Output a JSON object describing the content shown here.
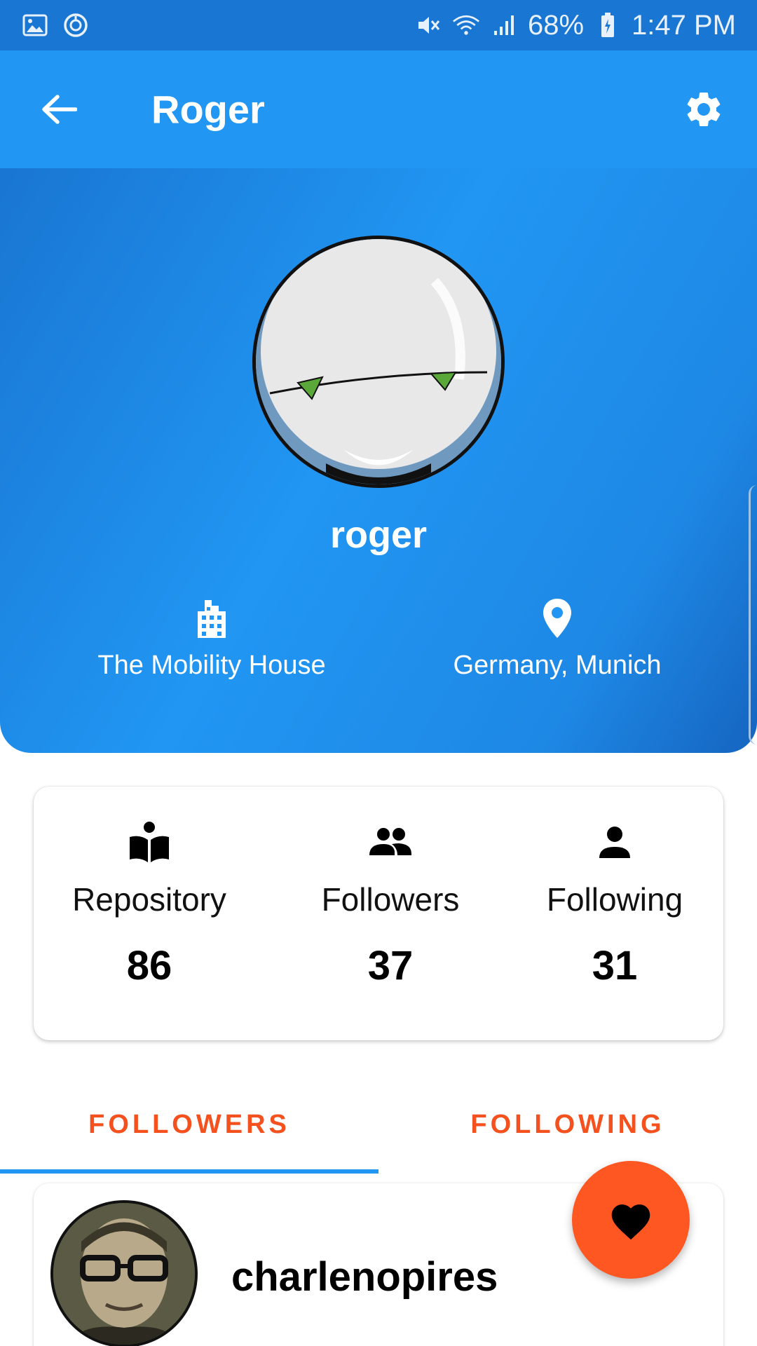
{
  "status_bar": {
    "battery": "68%",
    "time": "1:47 PM"
  },
  "app_bar": {
    "title": "Roger"
  },
  "profile": {
    "username": "roger",
    "company": "The Mobility House",
    "location": "Germany, Munich"
  },
  "stats": {
    "repository": {
      "label": "Repository",
      "value": "86"
    },
    "followers": {
      "label": "Followers",
      "value": "37"
    },
    "following": {
      "label": "Following",
      "value": "31"
    }
  },
  "tabs": [
    {
      "label": "FOLLOWERS",
      "selected": true
    },
    {
      "label": "FOLLOWING",
      "selected": false
    }
  ],
  "list": [
    {
      "name": "charlenopires"
    }
  ],
  "colors": {
    "status_bar": "#1976D2",
    "app_bar": "#2196F3",
    "accent": "#F4511E",
    "fab": "#FF5722"
  },
  "icons": [
    "image-icon",
    "sync-icon",
    "mute-icon",
    "wifi-icon",
    "signal-icon",
    "battery-icon",
    "back-arrow-icon",
    "gear-icon",
    "building-icon",
    "location-pin-icon",
    "book-reader-icon",
    "people-icon",
    "person-icon",
    "heart-icon"
  ]
}
